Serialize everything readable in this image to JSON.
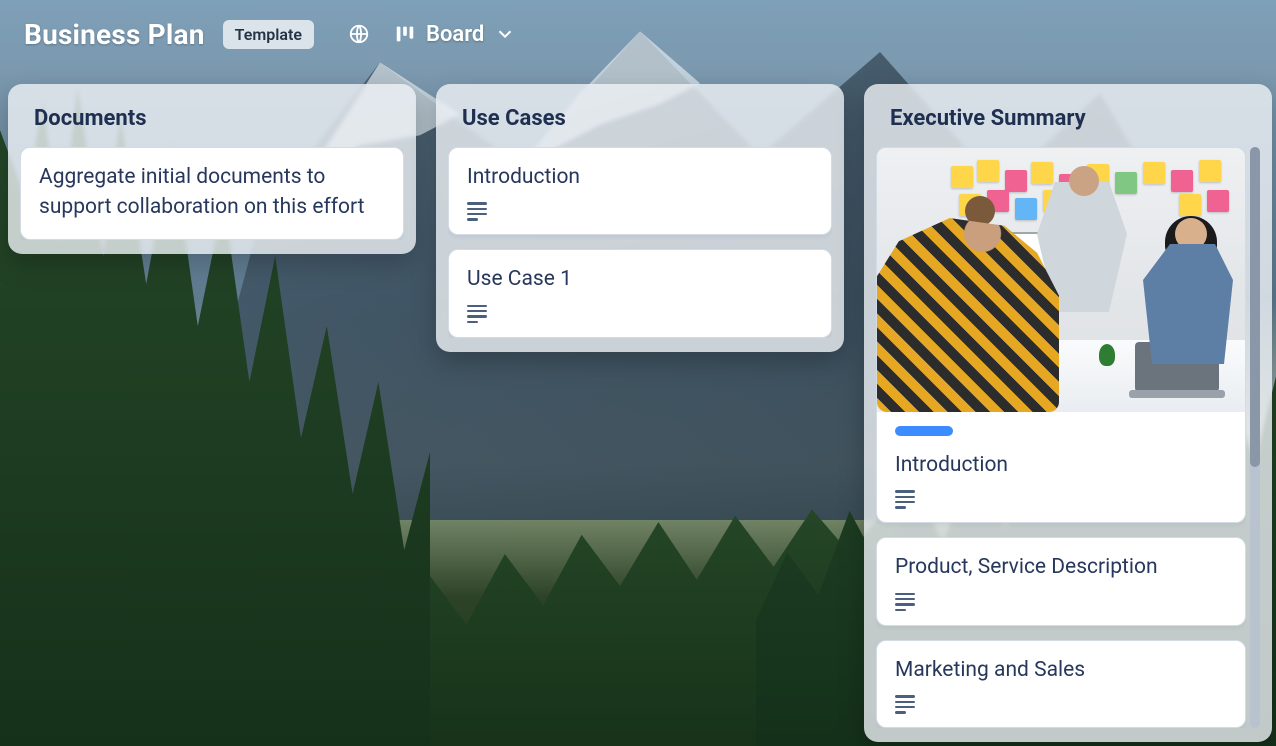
{
  "header": {
    "title": "Business Plan",
    "chip": "Template",
    "view_label": "Board"
  },
  "columns": [
    {
      "title": "Documents",
      "show_scrollbar": false,
      "cards": [
        {
          "title": "Aggregate initial documents to support collaboration on this effort",
          "has_description": false,
          "has_cover": false,
          "has_label": false
        }
      ]
    },
    {
      "title": "Use Cases",
      "show_scrollbar": false,
      "cards": [
        {
          "title": "Introduction",
          "has_description": true,
          "has_cover": false,
          "has_label": false
        },
        {
          "title": "Use Case 1",
          "has_description": true,
          "has_cover": false,
          "has_label": false
        }
      ]
    },
    {
      "title": "Executive Summary",
      "show_scrollbar": true,
      "cards": [
        {
          "title": "Introduction",
          "has_description": true,
          "has_cover": true,
          "has_label": true
        },
        {
          "title": "Product, Service Description",
          "has_description": true,
          "has_cover": false,
          "has_label": false
        },
        {
          "title": "Marketing and Sales",
          "has_description": true,
          "has_cover": false,
          "has_label": false
        }
      ]
    }
  ]
}
